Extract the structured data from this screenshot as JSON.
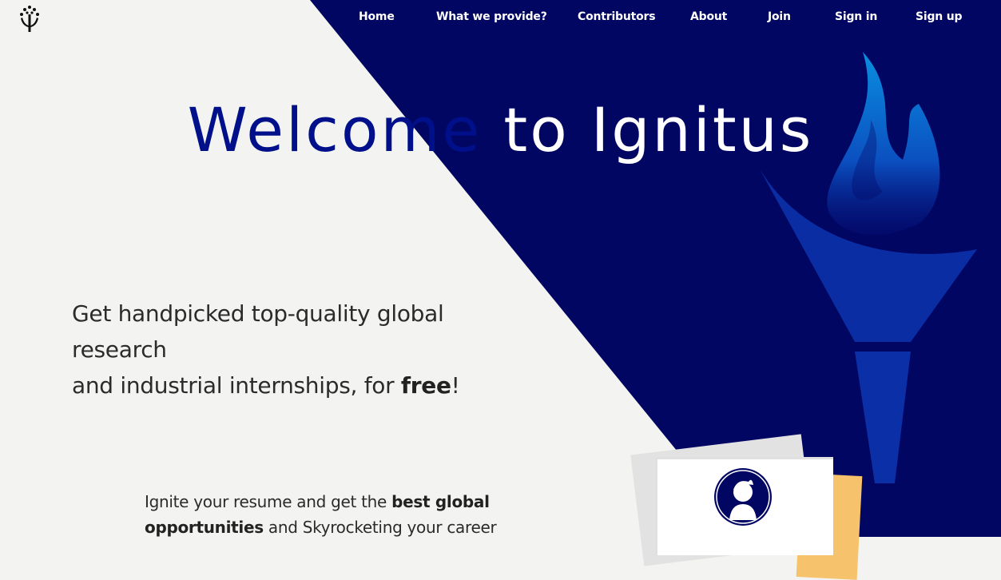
{
  "brand": {
    "logo_icon": "tree-hands-icon"
  },
  "nav": {
    "items": [
      {
        "label": "Home"
      },
      {
        "label": "What we provide?"
      },
      {
        "label": "Contributors"
      },
      {
        "label": "About"
      },
      {
        "label": "Join"
      },
      {
        "label": "Sign in"
      },
      {
        "label": "Sign up"
      }
    ]
  },
  "hero": {
    "title_part1": "Welcome to ",
    "title_part2": "Ignitus",
    "title_dark_portion": "Welcome ",
    "title_light_portion": "to Ignitus"
  },
  "tagline": {
    "line1": "Get handpicked top-quality global",
    "line2": "research",
    "line3_prefix": "and industrial internships, for ",
    "line3_bold": "free",
    "line3_suffix": "!"
  },
  "subtag": {
    "part1": "Ignite your resume and get the ",
    "bold1": "best global",
    "bold2": "opportunities",
    "part2": " and Skyrocketing your career"
  },
  "colors": {
    "navy": "#020663",
    "title_blue": "#000f8a",
    "light_bg": "#f3f3f1",
    "torch_blue": "#0b2fa6",
    "flame_cyan": "#0a8fe0",
    "card_orange": "#f6c26b"
  },
  "illustration": {
    "torch_icon": "torch-icon",
    "avatar_icon": "user-avatar-icon"
  }
}
